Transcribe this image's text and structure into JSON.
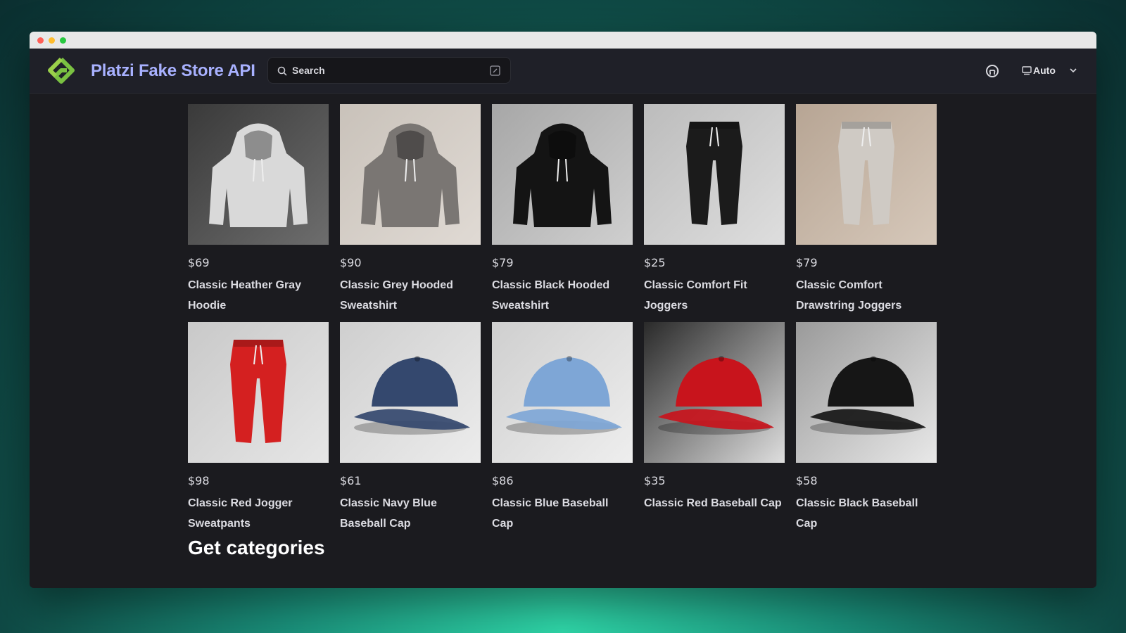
{
  "window": {
    "controls": [
      "close",
      "minimize",
      "maximize"
    ]
  },
  "navbar": {
    "title": "Platzi Fake Store API",
    "search_placeholder": "Search",
    "theme_label": "Auto",
    "icons": [
      "logo-icon",
      "search-icon",
      "shortcut-icon",
      "github-icon",
      "display-icon",
      "chevron-down-icon"
    ]
  },
  "products": [
    {
      "price": "$69",
      "name": "Classic Heather Gray Hoodie",
      "kind": "hoodie-light"
    },
    {
      "price": "$90",
      "name": "Classic Grey Hooded Sweatshirt",
      "kind": "hoodie-grey"
    },
    {
      "price": "$79",
      "name": "Classic Black Hooded Sweatshirt",
      "kind": "hoodie-black"
    },
    {
      "price": "$25",
      "name": "Classic Comfort Fit Joggers",
      "kind": "joggers-black"
    },
    {
      "price": "$79",
      "name": "Classic Comfort Drawstring Joggers",
      "kind": "joggers-grey"
    },
    {
      "price": "$98",
      "name": "Classic Red Jogger Sweatpants",
      "kind": "joggers-red"
    },
    {
      "price": "$61",
      "name": "Classic Navy Blue Baseball Cap",
      "kind": "cap-navy"
    },
    {
      "price": "$86",
      "name": "Classic Blue Baseball Cap",
      "kind": "cap-blue"
    },
    {
      "price": "$35",
      "name": "Classic Red Baseball Cap",
      "kind": "cap-red"
    },
    {
      "price": "$58",
      "name": "Classic Black Baseball Cap",
      "kind": "cap-black"
    }
  ],
  "section_heading": "Get categories",
  "colors": {
    "title": "#a8b1ff",
    "background": "#1b1b1f",
    "logo": "#7ac142"
  }
}
